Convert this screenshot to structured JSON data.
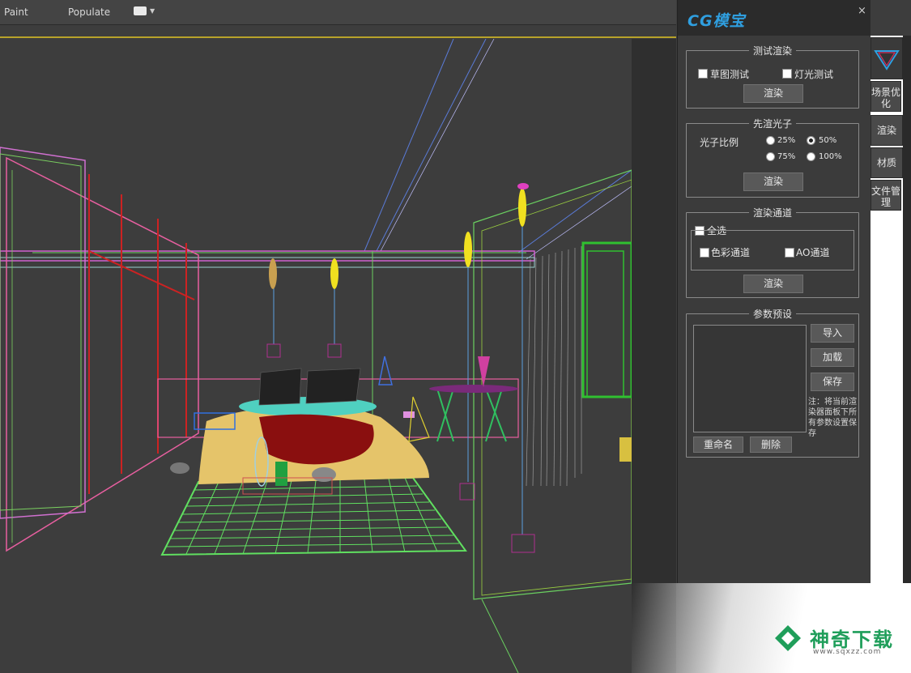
{
  "menu": {
    "items": [
      "Paint",
      "Populate"
    ]
  },
  "panel": {
    "logo": "CG模宝",
    "close": "×",
    "test_render": {
      "title": "测试渲染",
      "sketch_test": "草图测试",
      "light_test": "灯光测试",
      "render_btn": "渲染"
    },
    "photon": {
      "title": "先渲光子",
      "ratio_label": "光子比例",
      "options": [
        "25%",
        "50%",
        "75%",
        "100%"
      ],
      "selected": "50%",
      "render_btn": "渲染"
    },
    "channels": {
      "title": "渲染通道",
      "select_all": "全选",
      "color_channel": "色彩通道",
      "ao_channel": "AO通道",
      "render_btn": "渲染"
    },
    "presets": {
      "title": "参数预设",
      "import_btn": "导入",
      "load_btn": "加载",
      "save_btn": "保存",
      "note": "注：将当前渲染器面板下所有参数设置保存",
      "rename_btn": "重命名",
      "delete_btn": "删除"
    }
  },
  "side_tabs": [
    "场景优化",
    "渲染",
    "材质",
    "文件管理"
  ],
  "watermark": {
    "text": "神奇下载",
    "url": "www.sqxzz.com",
    "color": "#1f9e5a"
  }
}
